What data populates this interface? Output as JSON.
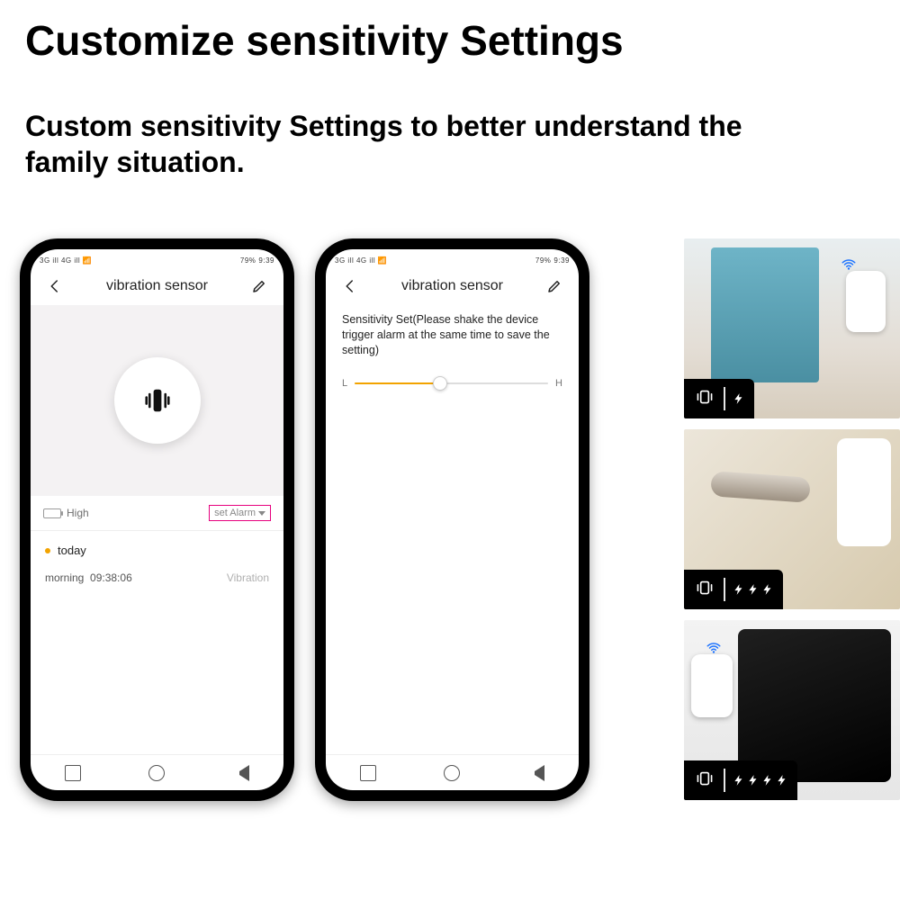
{
  "heading": "Customize sensitivity Settings",
  "subtext": "Custom sensitivity Settings to better understand the family situation.",
  "status": {
    "left": "3G ill  4G ill  📶",
    "right": "ℕ 🔵 ⚙ 🔕 79% 🔲 9:39",
    "battery_pct": "79%",
    "time": "9:39"
  },
  "app": {
    "title": "vibration sensor"
  },
  "screen1": {
    "battery_label": "High",
    "set_alarm": "set Alarm",
    "log_day": "today",
    "log_prefix": "morning",
    "log_time": "09:38:06",
    "log_label": "Vibration"
  },
  "screen2": {
    "desc": "Sensitivity Set(Please shake the device trigger alarm at the same time to save the setting)",
    "low": "L",
    "high": "H",
    "slider_pct": 44
  },
  "thumbs": {
    "bolt_counts": [
      1,
      3,
      4
    ]
  }
}
